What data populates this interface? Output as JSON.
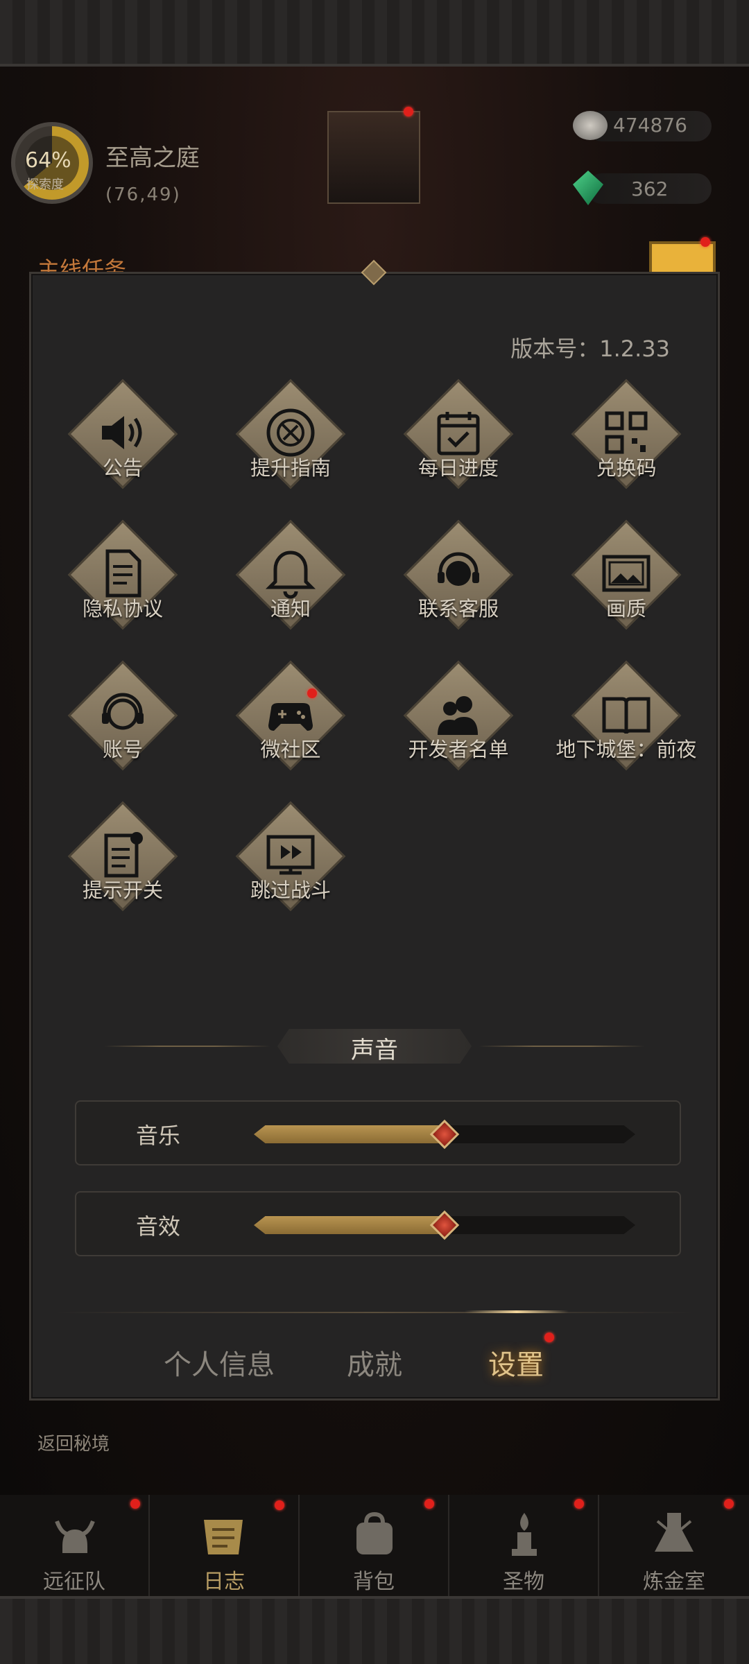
{
  "hud": {
    "explore_percent": "64%",
    "explore_label": "探索度",
    "location_name": "至高之庭",
    "coordinates": "(76,49)",
    "stone_count": "474876",
    "gem_count": "362",
    "quest_title": "主线任务",
    "return_label": "返回秘境"
  },
  "panel": {
    "version": "版本号：1.2.33",
    "grid": [
      {
        "label": "公告",
        "icon": "speaker-icon"
      },
      {
        "label": "提升指南",
        "icon": "compass-icon"
      },
      {
        "label": "每日进度",
        "icon": "calendar-check-icon"
      },
      {
        "label": "兑换码",
        "icon": "qr-code-icon"
      },
      {
        "label": "隐私协议",
        "icon": "document-icon"
      },
      {
        "label": "通知",
        "icon": "bell-icon"
      },
      {
        "label": "联系客服",
        "icon": "support-agent-icon"
      },
      {
        "label": "画质",
        "icon": "image-icon"
      },
      {
        "label": "账号",
        "icon": "headset-user-icon"
      },
      {
        "label": "微社区",
        "icon": "gamepad-icon"
      },
      {
        "label": "开发者名单",
        "icon": "people-icon"
      },
      {
        "label": "地下城堡：前夜",
        "icon": "book-icon"
      },
      {
        "label": "提示开关",
        "icon": "notice-toggle-icon"
      },
      {
        "label": "跳过战斗",
        "icon": "skip-battle-icon"
      }
    ],
    "sound_section_title": "声音",
    "sliders": [
      {
        "label": "音乐",
        "level": 0.5
      },
      {
        "label": "音效",
        "level": 0.5
      }
    ],
    "tabs": [
      {
        "label": "个人信息"
      },
      {
        "label": "成就"
      },
      {
        "label": "设置"
      }
    ]
  },
  "bottom_nav": [
    {
      "label": "远征队",
      "icon": "viking-helmet-icon"
    },
    {
      "label": "日志",
      "icon": "scroll-icon"
    },
    {
      "label": "背包",
      "icon": "backpack-icon"
    },
    {
      "label": "圣物",
      "icon": "relic-icon"
    },
    {
      "label": "炼金室",
      "icon": "alchemy-icon"
    }
  ]
}
